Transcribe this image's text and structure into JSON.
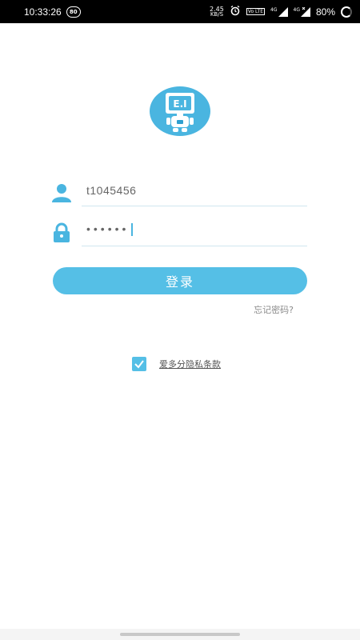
{
  "status_bar": {
    "time": "10:33:26",
    "notification_badge": "80",
    "net_speed_value": "2.45",
    "net_speed_unit": "KB/S",
    "volte_label": "Vo LTE",
    "sim1_label": "4G",
    "sim2_label": "4G",
    "battery_percent": "80%"
  },
  "logo": {
    "text": "E.I"
  },
  "login_form": {
    "username_value": "t1045456",
    "password_masked": "••••••",
    "login_button_label": "登录",
    "forgot_password_label": "忘记密码?"
  },
  "agreement": {
    "checked": true,
    "label": "爱多分隐私条款"
  },
  "colors": {
    "accent": "#55bfe6",
    "logo_bg": "#4ab5e0"
  }
}
